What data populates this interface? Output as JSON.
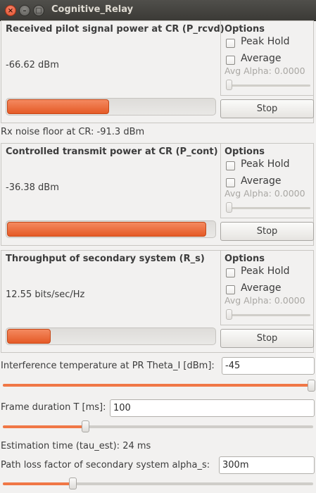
{
  "window": {
    "title": "Cognitive_Relay"
  },
  "panels": [
    {
      "title": "Received pilot signal power at CR (P_rcvd)",
      "value": "-66.62 dBm",
      "level": 0.49,
      "options": {
        "title": "Options",
        "peak_hold": "Peak Hold",
        "average": "Average",
        "alpha_label": "Avg Alpha: 0.0000",
        "alpha": 0.0
      },
      "stop": "Stop"
    },
    {
      "title": "Controlled transmit power at CR (P_cont)",
      "value": "-36.38 dBm",
      "level": 0.96,
      "options": {
        "title": "Options",
        "peak_hold": "Peak Hold",
        "average": "Average",
        "alpha_label": "Avg Alpha: 0.0000",
        "alpha": 0.0
      },
      "stop": "Stop"
    },
    {
      "title": "Throughput of secondary system (R_s)",
      "value": "12.55 bits/sec/Hz",
      "level": 0.21,
      "options": {
        "title": "Options",
        "peak_hold": "Peak Hold",
        "average": "Average",
        "alpha_label": "Avg Alpha: 0.0000",
        "alpha": 0.0
      },
      "stop": "Stop"
    }
  ],
  "noise_floor": "Rx noise floor at CR: -91.3 dBm",
  "params": {
    "theta": {
      "label": "Interference temperature at PR Theta_I [dBm]:",
      "value": "-45",
      "slider": 1.0
    },
    "frame": {
      "label": "Frame duration T [ms]:",
      "value": "100",
      "slider": 0.265
    },
    "estimation": "Estimation time (tau_est): 24 ms",
    "pathloss": {
      "label": "Path loss factor of secondary system alpha_s:",
      "value": "300m",
      "slider": 0.225
    }
  },
  "colors": {
    "accent": "#e55a26",
    "titlebar": "#3c3b37"
  }
}
